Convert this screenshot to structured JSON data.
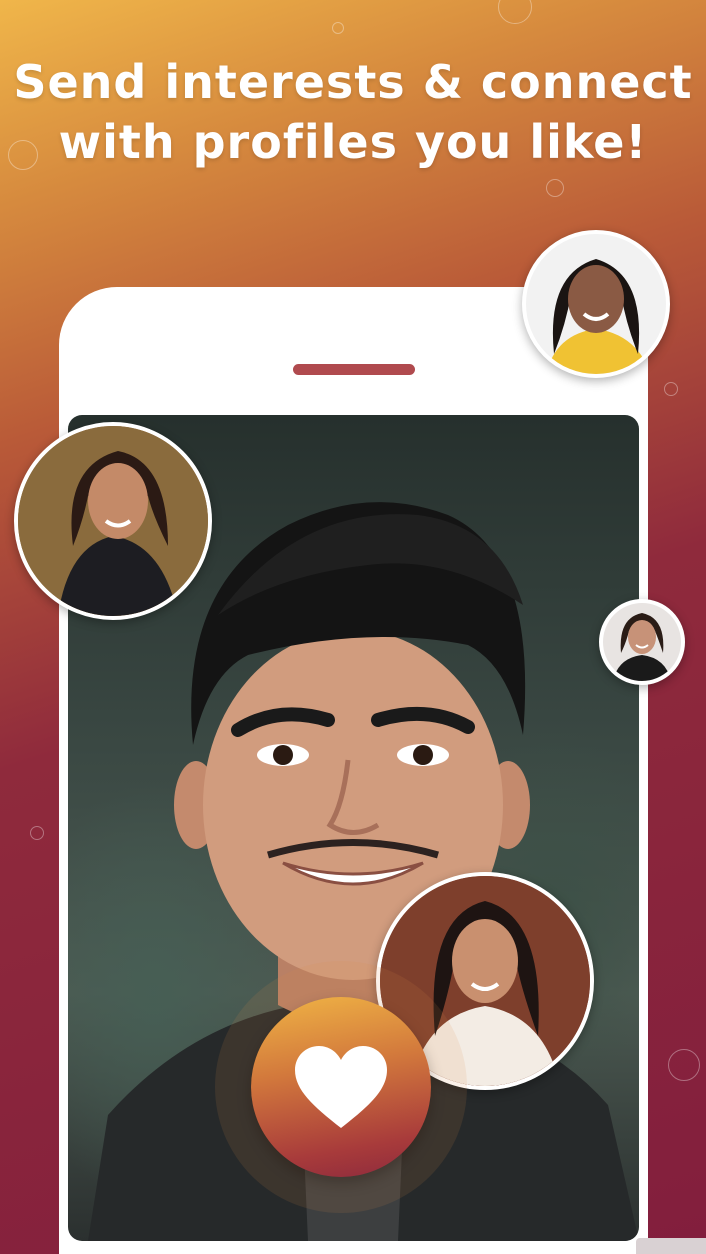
{
  "headline": {
    "line1": "Send interests & connect",
    "line2": "with profiles you like!"
  },
  "icons": {
    "like_button": "heart-icon"
  },
  "colors": {
    "gradient_top": "#f0b64a",
    "gradient_bottom": "#821e3d",
    "speaker": "#b04a4e",
    "heart_button_top": "#f0b445",
    "heart_button_bottom": "#8d2a3c"
  }
}
